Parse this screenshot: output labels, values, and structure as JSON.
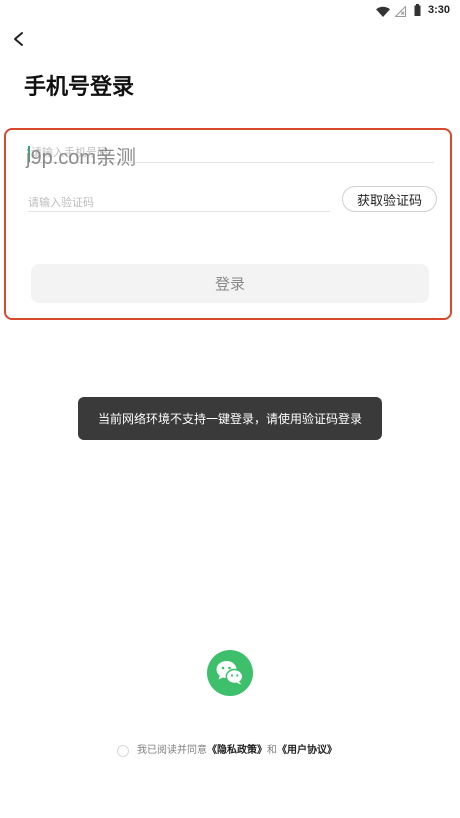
{
  "status_bar": {
    "time": "3:30",
    "icons": [
      "wifi-icon",
      "no-signal-icon",
      "battery-icon"
    ]
  },
  "header": {
    "back_icon": "chevron-left-icon",
    "title": "手机号登录"
  },
  "form": {
    "phone": {
      "placeholder": "请输入手机号码",
      "value": ""
    },
    "code": {
      "placeholder": "请输入验证码",
      "value": ""
    },
    "get_code_label": "获取验证码",
    "login_label": "登录"
  },
  "watermark": "j9p.com亲测",
  "toast": "当前网络环境不支持一键登录，请使用验证码登录",
  "wechat": {
    "icon": "wechat-icon"
  },
  "agreement": {
    "checked": false,
    "prefix": "我已阅读并同意",
    "privacy": "《隐私政策》",
    "and": "和",
    "terms": "《用户协议》"
  },
  "colors": {
    "highlight_border": "#d9482b",
    "wechat_green": "#3dbf6b",
    "cursor": "#2eaa6a"
  }
}
